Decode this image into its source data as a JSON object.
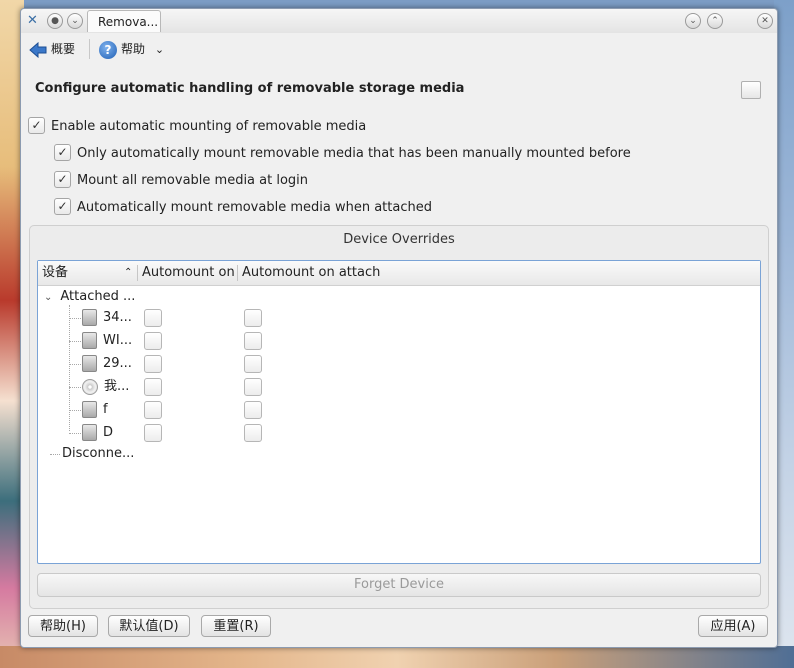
{
  "window": {
    "tab_title": "Remova...",
    "title_buttons": [
      "close-icon",
      "maximize-icon",
      "minimize-icon"
    ]
  },
  "toolbar": {
    "overview_label": "概要",
    "help_label": "帮助",
    "help_dropdown": "⌄"
  },
  "heading": "Configure automatic handling of removable storage media",
  "options": {
    "enable_automount": {
      "label": "Enable automatic mounting of removable media",
      "checked": true
    },
    "only_manual": {
      "label": "Only automatically mount removable media that has been manually mounted before",
      "checked": true
    },
    "mount_login": {
      "label": "Mount all removable media at login",
      "checked": true
    },
    "mount_attached": {
      "label": "Automatically mount removable media when attached",
      "checked": true
    }
  },
  "overrides": {
    "title": "Device Overrides",
    "columns": [
      "设备",
      "Automount on",
      "Automount on attach"
    ],
    "attached_label": "Attached ...",
    "disconnected_label": "Disconne...",
    "devices": [
      {
        "name": "34...",
        "icon": "drive-icon",
        "automount_on": false,
        "automount_attach": false
      },
      {
        "name": "WI...",
        "icon": "drive-icon",
        "automount_on": false,
        "automount_attach": false
      },
      {
        "name": "29...",
        "icon": "drive-icon",
        "automount_on": false,
        "automount_attach": false
      },
      {
        "name": "我...",
        "icon": "disc-icon",
        "automount_on": false,
        "automount_attach": false
      },
      {
        "name": "f",
        "icon": "drive-icon",
        "automount_on": false,
        "automount_attach": false
      },
      {
        "name": "D",
        "icon": "drive-icon",
        "automount_on": false,
        "automount_attach": false
      }
    ],
    "forget_label": "Forget Device"
  },
  "buttons": {
    "help": "帮助(H)",
    "defaults": "默认值(D)",
    "reset": "重置(R)",
    "apply": "应用(A)"
  },
  "colors": {
    "accent": "#7aa3d6",
    "window_bg": "#f0f0f0"
  }
}
